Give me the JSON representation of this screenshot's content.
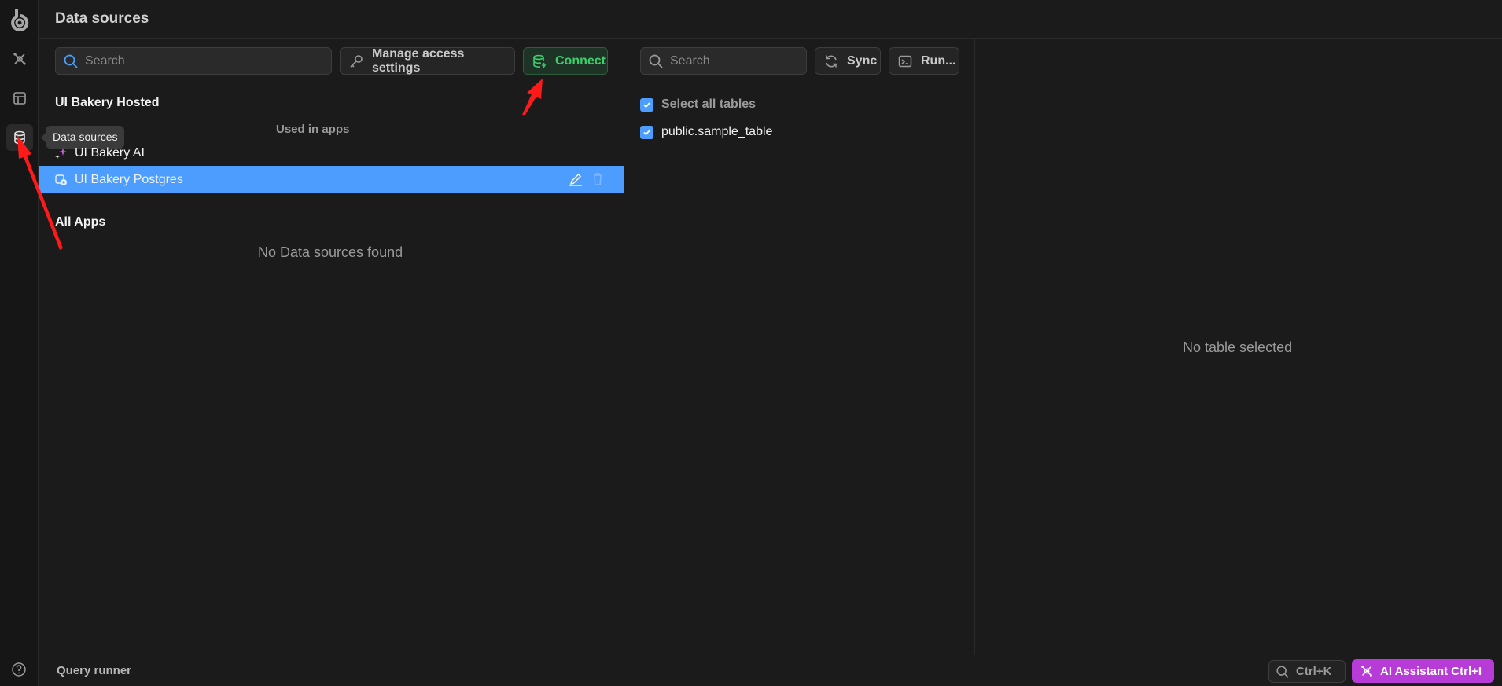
{
  "header": {
    "title": "Data sources"
  },
  "rail": {
    "tooltip": "Data sources",
    "icons": [
      "logo-icon",
      "ai-sparkle-icon",
      "table-icon",
      "database-icon",
      "help-icon"
    ]
  },
  "sources_panel": {
    "search_placeholder": "Search",
    "manage_label": "Manage access settings",
    "connect_label": "Connect",
    "hosted_title": "UI Bakery Hosted",
    "used_in_apps_label": "Used in apps",
    "items": [
      {
        "label": "UI Bakery AI"
      },
      {
        "label": "UI Bakery Postgres"
      }
    ],
    "all_apps_title": "All Apps",
    "empty_text": "No Data sources found"
  },
  "tables_panel": {
    "search_placeholder": "Search",
    "sync_label": "Sync",
    "run_label": "Run...",
    "select_all_label": "Select all tables",
    "tables": [
      {
        "label": "public.sample_table"
      }
    ]
  },
  "detail_panel": {
    "empty_text": "No table selected"
  },
  "footer": {
    "query_runner_label": "Query runner",
    "shortcut_label": "Ctrl+K",
    "ai_assistant_label": "AI Assistant Ctrl+I"
  },
  "colors": {
    "accent": "#4d9dff",
    "connect": "#3ecf6b",
    "ai": "#b73bd6",
    "annotation": "#ff1a1a"
  }
}
